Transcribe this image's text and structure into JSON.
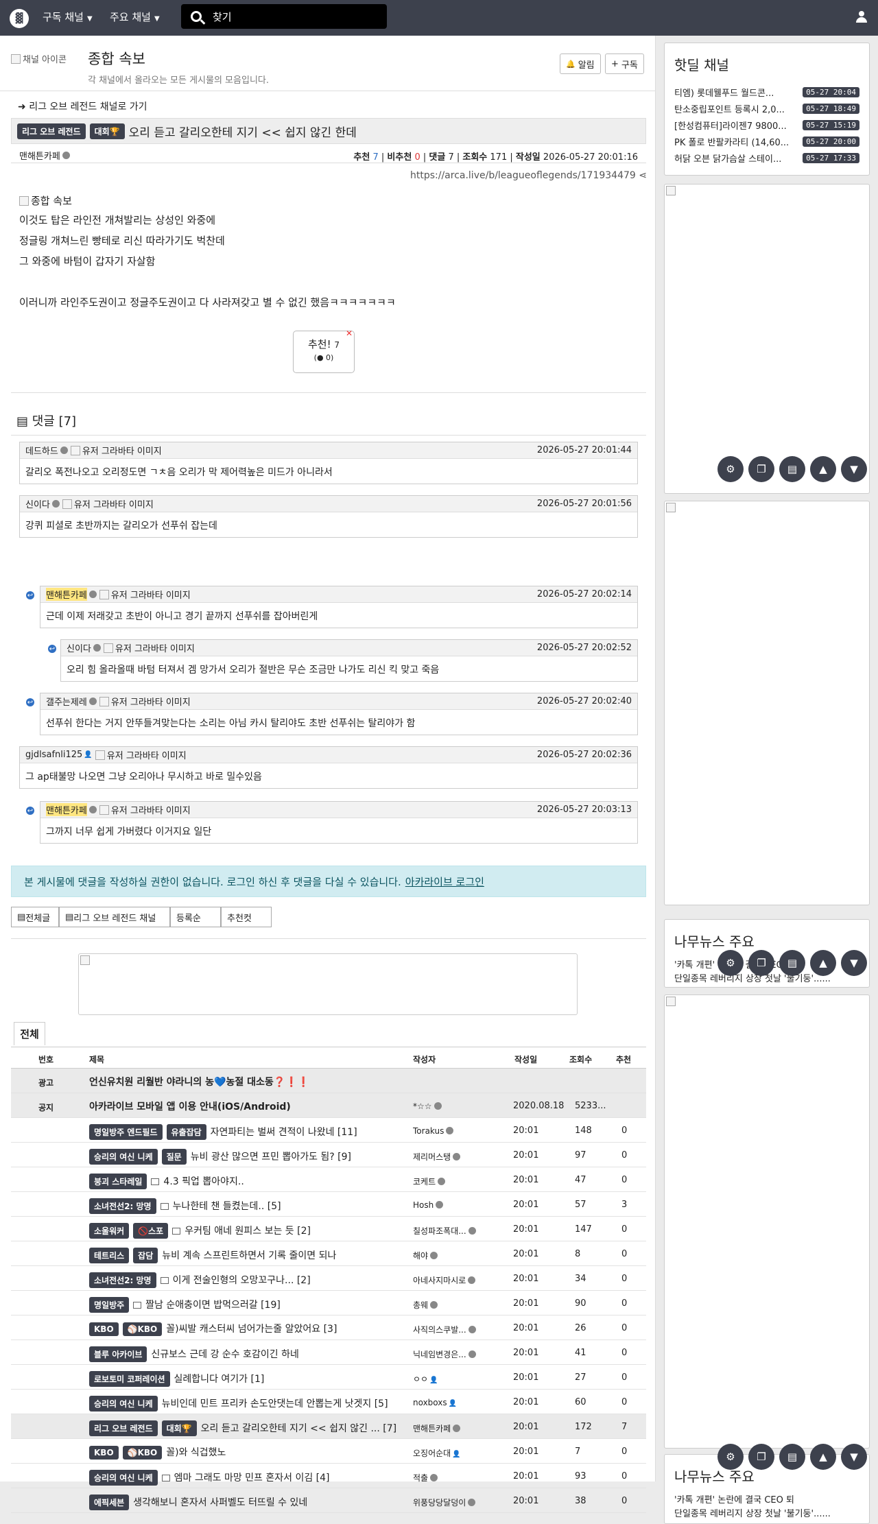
{
  "nav": {
    "logo": "▓",
    "menu1": "구독 채널",
    "menu2": "주요 채널",
    "search_placeholder": "찾기"
  },
  "board": {
    "channel_img_alt": "채널 아이콘",
    "title": "종합 속보",
    "desc": "각 채널에서 올라오는 모든 게시물의 모음입니다.",
    "notify": "알림",
    "subscribe": "구독"
  },
  "article": {
    "go_link": "리그 오브 레전드 채널로 가기",
    "badge1": "리그 오브 레전드",
    "badge2": "대회🏆",
    "title": "오리 듣고 갈리오한테 지기 << 쉽지 않긴 한데",
    "author": "맨해튼카페",
    "rec_label": "추천",
    "rec": "7",
    "unrec_label": "비추천",
    "unrec": "0",
    "cmt_label": "댓글",
    "cmt": "7",
    "view_label": "조회수",
    "views": "171",
    "date_label": "작성일",
    "date": "2026-05-27 20:01:16",
    "url": "https://arca.live/b/leagueoflegends/171934479",
    "img_alt": "종합 속보",
    "lines": [
      "이것도 탑은 라인전 개쳐발리는 상성인 와중에",
      "정글링 개쳐느린 빵테로 리신 따라가기도 벅찬데",
      "그 와중에 바텀이 갑자기 자살함",
      "이러니까 라인주도권이고 정글주도권이고 다 사라져갖고 별 수 없긴 했음ㅋㅋㅋㅋㅋㅋㅋ"
    ],
    "rec_btn": "추천!",
    "rec_btn_count": "7",
    "rec_btn_sub": "0"
  },
  "comments_title": "댓글 [7]",
  "comments": [
    {
      "nick": "데드하드",
      "avatar": "유저 그라바타 이미지",
      "time": "2026-05-27 20:01:44",
      "text": "갈리오 폭전나오고 오리정도면 ㄱㅊ음 오리가 막 제어력높은 미드가 아니라서"
    },
    {
      "nick": "신이다",
      "avatar": "유저 그라바타 이미지",
      "time": "2026-05-27 20:01:56",
      "text": "강퀴 피셜로 초반까지는 갈리오가 선푸쉬 잡는데"
    },
    {
      "nick": "맨해튼카페",
      "avatar": "유저 그라바타 이미지",
      "time": "2026-05-27 20:02:14",
      "text": "근데 이제 저래갖고 초반이 아니고 경기 끝까지 선푸쉬를 잡아버린게"
    },
    {
      "nick": "신이다",
      "avatar": "유저 그라바타 이미지",
      "time": "2026-05-27 20:02:52",
      "text": "오리 힘 올라올때 바텀 터져서 겜 망가서 오리가 절반은 무슨 조금만 나가도 리신 킥 맞고 죽음"
    },
    {
      "nick": "갤주는제레",
      "avatar": "유저 그라바타 이미지",
      "time": "2026-05-27 20:02:40",
      "text": "선푸쉬 한다는 거지 안뚜들겨맞는다는 소리는 아님 카시 탈리야도 초반 선푸쉬는 탈리야가 함"
    },
    {
      "nick": "gjdlsafnli125",
      "avatar": "유저 그라바타 이미지",
      "time": "2026-05-27 20:02:36",
      "text": "그 ap태불망 나오면 그냥 오리아나 무시하고 바로 밀수있음"
    },
    {
      "nick": "맨해튼카페",
      "avatar": "유저 그라바타 이미지",
      "time": "2026-05-27 20:03:13",
      "text": "그까지 너무 쉽게 가버렸다 이거지요 일단"
    }
  ],
  "notice": {
    "text": "본 게시물에 댓글을 작성하실 권한이 없습니다. 로그인 하신 후 댓글을 다실 수 있습니다.",
    "link": "아카라이브 로그인"
  },
  "tabs": [
    "전체글",
    "리그 오브 레전드 채널",
    "등록순",
    "추천컷"
  ],
  "list": {
    "tab": "전체",
    "headers": [
      "번호",
      "제목",
      "작성자",
      "작성일",
      "조회수",
      "추천"
    ],
    "rows": [
      {
        "num": "광고",
        "badges": [],
        "title": "언신유치원 리월반 야라니의 농💙농절 대소동❓❗❗",
        "author": "",
        "date": "",
        "views": "",
        "rec": "",
        "gray": true
      },
      {
        "num": "공지",
        "badges": [],
        "title": "아카라이브 모바일 앱 이용 안내(iOS/Android)",
        "author": "*☆☆",
        "date": "2020.08.18",
        "views": "5233...",
        "rec": "",
        "gray": true
      },
      {
        "num": "",
        "badges": [
          "명일방주 엔드필드",
          "유출잡담"
        ],
        "title": "자연파티는 벌써 견적이 나왔네 [11]",
        "author": "Torakus",
        "date": "20:01",
        "views": "148",
        "rec": "0"
      },
      {
        "num": "",
        "badges": [
          "승리의 여신 니케",
          "질문"
        ],
        "title": "뉴비 광산 많으면 프민 뽑아가도 됨? [9]",
        "author": "제리머스탱",
        "date": "20:01",
        "views": "97",
        "rec": "0"
      },
      {
        "num": "",
        "badges": [
          "붕괴 스타레일"
        ],
        "title": "4.3 픽업 뽑아야지..",
        "author": "코케트",
        "date": "20:01",
        "views": "47",
        "rec": "0",
        "pic": true
      },
      {
        "num": "",
        "badges": [
          "소녀전선2: 망명"
        ],
        "title": "누나한테 챈 들켰는데.. [5]",
        "author": "Hosh",
        "date": "20:01",
        "views": "57",
        "rec": "3",
        "pic": true
      },
      {
        "num": "",
        "badges": [
          "소울워커",
          "🚫스포"
        ],
        "title": "우커팀 애네 원피스 보는 듯 [2]",
        "author": "칠성파조폭대...",
        "date": "20:01",
        "views": "147",
        "rec": "0",
        "pic": true
      },
      {
        "num": "",
        "badges": [
          "테트리스",
          "잡담"
        ],
        "title": "뉴비 계속 스프린트하면서 기록 줄이면 되나",
        "author": "해야",
        "date": "20:01",
        "views": "8",
        "rec": "0"
      },
      {
        "num": "",
        "badges": [
          "소녀전선2: 망명"
        ],
        "title": "이게 전술인형의 오망꼬구나... [2]",
        "author": "아네사지마시로",
        "date": "20:01",
        "views": "34",
        "rec": "0",
        "pic": true
      },
      {
        "num": "",
        "badges": [
          "명일방주"
        ],
        "title": "짤남 순애충이면 밥먹으러갈 [19]",
        "author": "총웨",
        "date": "20:01",
        "views": "90",
        "rec": "0",
        "pic": true
      },
      {
        "num": "",
        "badges": [
          "KBO",
          "⚾KBO"
        ],
        "title": "꼴)씨발 캐스터씨 넘어가는줄 알았어요 [3]",
        "author": "사직의스쿠발...",
        "date": "20:01",
        "views": "26",
        "rec": "0"
      },
      {
        "num": "",
        "badges": [
          "블루 아카이브"
        ],
        "title": "신규보스 근데 강 순수 호감이긴 하네",
        "author": "닉네임변경은...",
        "date": "20:01",
        "views": "41",
        "rec": "0"
      },
      {
        "num": "",
        "badges": [
          "로보토미 코퍼레이션"
        ],
        "title": "실례합니다 여기가 [1]",
        "author": "ㅇㅇ",
        "date": "20:01",
        "views": "27",
        "rec": "0"
      },
      {
        "num": "",
        "badges": [
          "승리의 여신 니케"
        ],
        "title": "뉴비인데 민트 프리카 손도안댓는데 안뽑는게 낫겟지 [5]",
        "author": "noxboxs",
        "date": "20:01",
        "views": "60",
        "rec": "0"
      },
      {
        "num": "",
        "badges": [
          "리그 오브 레전드",
          "대회🏆"
        ],
        "title": "오리 듣고 갈리오한테 지기 << 쉽지 않긴 ... [7]",
        "author": "맨해튼카페",
        "date": "20:01",
        "views": "172",
        "rec": "7",
        "gray": true
      },
      {
        "num": "",
        "badges": [
          "KBO",
          "⚾KBO"
        ],
        "title": "꼴)와 식겁했노",
        "author": "오징어순대",
        "date": "20:01",
        "views": "7",
        "rec": "0"
      },
      {
        "num": "",
        "badges": [
          "승리의 여신 니케"
        ],
        "title": "엠마 그래도 마망 민프 혼자서 이김 [4]",
        "author": "적출",
        "date": "20:01",
        "views": "93",
        "rec": "0",
        "pic": true
      },
      {
        "num": "",
        "badges": [
          "에픽세븐"
        ],
        "title": "생각해보니 혼자서 사퍼벨도 터뜨릴 수 있네",
        "author": "위풍당당달덩이",
        "date": "20:01",
        "views": "38",
        "rec": "0"
      }
    ]
  },
  "side": {
    "hot_title": "핫딜 채널",
    "hot": [
      {
        "t": "티엠) 롯데웰푸드 월드콘...",
        "d": "05-27 20:04"
      },
      {
        "t": "탄소중립포인트 등록시 2,0...",
        "d": "05-27 18:49"
      },
      {
        "t": "[한성컴퓨터]라이젠7 9800...",
        "d": "05-27 15:19"
      },
      {
        "t": "PK 폴로 반팔카라티 (14,60...",
        "d": "05-27 20:00"
      },
      {
        "t": "허닭 오븐 닭가슴살 스테이...",
        "d": "05-27 17:33"
      }
    ],
    "news_title": "나무뉴스 주요",
    "news": [
      "'카톡 개편' 논란에 결국 CEO 퇴",
      "단일종목 레버리지 상장 첫날 '불기둥'......"
    ]
  },
  "float_icons": [
    "gear-icon",
    "copy-icon",
    "list-icon",
    "up-icon",
    "down-icon"
  ]
}
